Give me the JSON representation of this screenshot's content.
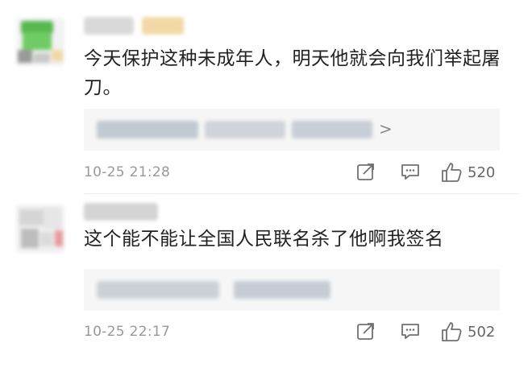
{
  "comments": [
    {
      "text": "今天保护这种未成年人，明天他就会向我们举起屠刀。",
      "reply_chevron": ">",
      "timestamp": "10-25 21:28",
      "like_count": "520",
      "icons": [
        "share-icon",
        "comment-icon",
        "thumbs-up-icon"
      ]
    },
    {
      "text": "这个能不能让全国人民联名杀了他啊我签名",
      "timestamp": "10-25 22:17",
      "like_count": "502",
      "icons": [
        "share-icon",
        "comment-icon",
        "thumbs-up-icon"
      ]
    }
  ],
  "colors": {
    "text": "#222222",
    "meta": "#999999",
    "reply_bg": "#f6f6f6",
    "icon": "#6f6f6f"
  }
}
